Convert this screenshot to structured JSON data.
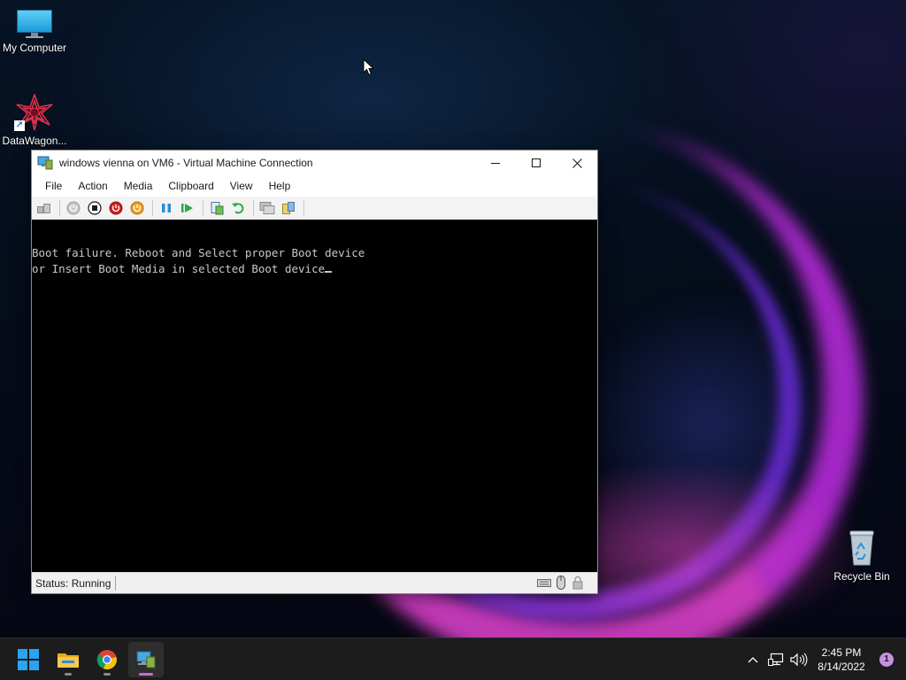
{
  "desktop": {
    "icons": [
      {
        "label": "My Computer",
        "icon": "monitor-icon"
      },
      {
        "label": "DataWagon...",
        "icon": "datawagon-icon"
      },
      {
        "label": "Recycle Bin",
        "icon": "recycle-bin-icon"
      }
    ]
  },
  "vm_window": {
    "title": "windows vienna on VM6 - Virtual Machine Connection",
    "app_icon": "vm-connection-icon",
    "controls": {
      "minimize": "minimize-icon",
      "maximize": "maximize-icon",
      "close": "close-icon"
    },
    "menu": [
      "File",
      "Action",
      "Media",
      "Clipboard",
      "View",
      "Help"
    ],
    "toolbar_icons": [
      "ctrl-alt-del-icon",
      "start-icon",
      "turn-off-icon",
      "shut-down-icon",
      "save-icon",
      "pause-icon",
      "reset-icon",
      "checkpoint-icon",
      "revert-icon",
      "enhanced-session-icon",
      "share-icon"
    ],
    "screen": {
      "lines": [
        "Boot failure. Reboot and Select proper Boot device",
        "or Insert Boot Media in selected Boot device"
      ]
    },
    "status": {
      "text": "Status: Running",
      "icons": [
        "keyboard-icon",
        "mouse-icon",
        "lock-icon"
      ]
    }
  },
  "taskbar": {
    "apps": [
      {
        "name": "start-button",
        "icon": "windows-logo-icon"
      },
      {
        "name": "file-explorer",
        "icon": "folder-icon"
      },
      {
        "name": "chrome",
        "icon": "chrome-icon"
      },
      {
        "name": "vm-connection",
        "icon": "vm-connection-icon"
      }
    ],
    "tray": {
      "icons": [
        "chevron-up-icon",
        "network-icon",
        "volume-icon"
      ],
      "time": "2:45 PM",
      "date": "8/14/2022",
      "notification_count": "1"
    }
  },
  "colors": {
    "taskbar_bg": "#1c1c1c",
    "active_indicator": "#c86cd8",
    "boot_text": "#c8c8c8"
  }
}
